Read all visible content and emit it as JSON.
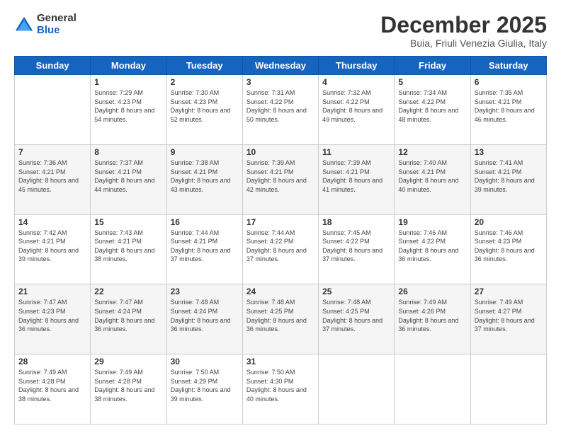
{
  "logo": {
    "general": "General",
    "blue": "Blue"
  },
  "header": {
    "month": "December 2025",
    "location": "Buia, Friuli Venezia Giulia, Italy"
  },
  "days_of_week": [
    "Sunday",
    "Monday",
    "Tuesday",
    "Wednesday",
    "Thursday",
    "Friday",
    "Saturday"
  ],
  "weeks": [
    [
      {
        "day": "",
        "sunrise": "",
        "sunset": "",
        "daylight": "",
        "empty": true
      },
      {
        "day": "1",
        "sunrise": "Sunrise: 7:29 AM",
        "sunset": "Sunset: 4:23 PM",
        "daylight": "Daylight: 8 hours and 54 minutes."
      },
      {
        "day": "2",
        "sunrise": "Sunrise: 7:30 AM",
        "sunset": "Sunset: 4:23 PM",
        "daylight": "Daylight: 8 hours and 52 minutes."
      },
      {
        "day": "3",
        "sunrise": "Sunrise: 7:31 AM",
        "sunset": "Sunset: 4:22 PM",
        "daylight": "Daylight: 8 hours and 50 minutes."
      },
      {
        "day": "4",
        "sunrise": "Sunrise: 7:32 AM",
        "sunset": "Sunset: 4:22 PM",
        "daylight": "Daylight: 8 hours and 49 minutes."
      },
      {
        "day": "5",
        "sunrise": "Sunrise: 7:34 AM",
        "sunset": "Sunset: 4:22 PM",
        "daylight": "Daylight: 8 hours and 48 minutes."
      },
      {
        "day": "6",
        "sunrise": "Sunrise: 7:35 AM",
        "sunset": "Sunset: 4:21 PM",
        "daylight": "Daylight: 8 hours and 46 minutes."
      }
    ],
    [
      {
        "day": "7",
        "sunrise": "Sunrise: 7:36 AM",
        "sunset": "Sunset: 4:21 PM",
        "daylight": "Daylight: 8 hours and 45 minutes."
      },
      {
        "day": "8",
        "sunrise": "Sunrise: 7:37 AM",
        "sunset": "Sunset: 4:21 PM",
        "daylight": "Daylight: 8 hours and 44 minutes."
      },
      {
        "day": "9",
        "sunrise": "Sunrise: 7:38 AM",
        "sunset": "Sunset: 4:21 PM",
        "daylight": "Daylight: 8 hours and 43 minutes."
      },
      {
        "day": "10",
        "sunrise": "Sunrise: 7:39 AM",
        "sunset": "Sunset: 4:21 PM",
        "daylight": "Daylight: 8 hours and 42 minutes."
      },
      {
        "day": "11",
        "sunrise": "Sunrise: 7:39 AM",
        "sunset": "Sunset: 4:21 PM",
        "daylight": "Daylight: 8 hours and 41 minutes."
      },
      {
        "day": "12",
        "sunrise": "Sunrise: 7:40 AM",
        "sunset": "Sunset: 4:21 PM",
        "daylight": "Daylight: 8 hours and 40 minutes."
      },
      {
        "day": "13",
        "sunrise": "Sunrise: 7:41 AM",
        "sunset": "Sunset: 4:21 PM",
        "daylight": "Daylight: 8 hours and 39 minutes."
      }
    ],
    [
      {
        "day": "14",
        "sunrise": "Sunrise: 7:42 AM",
        "sunset": "Sunset: 4:21 PM",
        "daylight": "Daylight: 8 hours and 39 minutes."
      },
      {
        "day": "15",
        "sunrise": "Sunrise: 7:43 AM",
        "sunset": "Sunset: 4:21 PM",
        "daylight": "Daylight: 8 hours and 38 minutes."
      },
      {
        "day": "16",
        "sunrise": "Sunrise: 7:44 AM",
        "sunset": "Sunset: 4:21 PM",
        "daylight": "Daylight: 8 hours and 37 minutes."
      },
      {
        "day": "17",
        "sunrise": "Sunrise: 7:44 AM",
        "sunset": "Sunset: 4:22 PM",
        "daylight": "Daylight: 8 hours and 37 minutes."
      },
      {
        "day": "18",
        "sunrise": "Sunrise: 7:45 AM",
        "sunset": "Sunset: 4:22 PM",
        "daylight": "Daylight: 8 hours and 37 minutes."
      },
      {
        "day": "19",
        "sunrise": "Sunrise: 7:46 AM",
        "sunset": "Sunset: 4:22 PM",
        "daylight": "Daylight: 8 hours and 36 minutes."
      },
      {
        "day": "20",
        "sunrise": "Sunrise: 7:46 AM",
        "sunset": "Sunset: 4:23 PM",
        "daylight": "Daylight: 8 hours and 36 minutes."
      }
    ],
    [
      {
        "day": "21",
        "sunrise": "Sunrise: 7:47 AM",
        "sunset": "Sunset: 4:23 PM",
        "daylight": "Daylight: 8 hours and 36 minutes."
      },
      {
        "day": "22",
        "sunrise": "Sunrise: 7:47 AM",
        "sunset": "Sunset: 4:24 PM",
        "daylight": "Daylight: 8 hours and 36 minutes."
      },
      {
        "day": "23",
        "sunrise": "Sunrise: 7:48 AM",
        "sunset": "Sunset: 4:24 PM",
        "daylight": "Daylight: 8 hours and 36 minutes."
      },
      {
        "day": "24",
        "sunrise": "Sunrise: 7:48 AM",
        "sunset": "Sunset: 4:25 PM",
        "daylight": "Daylight: 8 hours and 36 minutes."
      },
      {
        "day": "25",
        "sunrise": "Sunrise: 7:48 AM",
        "sunset": "Sunset: 4:25 PM",
        "daylight": "Daylight: 8 hours and 37 minutes."
      },
      {
        "day": "26",
        "sunrise": "Sunrise: 7:49 AM",
        "sunset": "Sunset: 4:26 PM",
        "daylight": "Daylight: 8 hours and 36 minutes."
      },
      {
        "day": "27",
        "sunrise": "Sunrise: 7:49 AM",
        "sunset": "Sunset: 4:27 PM",
        "daylight": "Daylight: 8 hours and 37 minutes."
      }
    ],
    [
      {
        "day": "28",
        "sunrise": "Sunrise: 7:49 AM",
        "sunset": "Sunset: 4:28 PM",
        "daylight": "Daylight: 8 hours and 38 minutes."
      },
      {
        "day": "29",
        "sunrise": "Sunrise: 7:49 AM",
        "sunset": "Sunset: 4:28 PM",
        "daylight": "Daylight: 8 hours and 38 minutes."
      },
      {
        "day": "30",
        "sunrise": "Sunrise: 7:50 AM",
        "sunset": "Sunset: 4:29 PM",
        "daylight": "Daylight: 8 hours and 39 minutes."
      },
      {
        "day": "31",
        "sunrise": "Sunrise: 7:50 AM",
        "sunset": "Sunset: 4:30 PM",
        "daylight": "Daylight: 8 hours and 40 minutes."
      },
      {
        "day": "",
        "sunrise": "",
        "sunset": "",
        "daylight": "",
        "empty": true
      },
      {
        "day": "",
        "sunrise": "",
        "sunset": "",
        "daylight": "",
        "empty": true
      },
      {
        "day": "",
        "sunrise": "",
        "sunset": "",
        "daylight": "",
        "empty": true
      }
    ]
  ]
}
